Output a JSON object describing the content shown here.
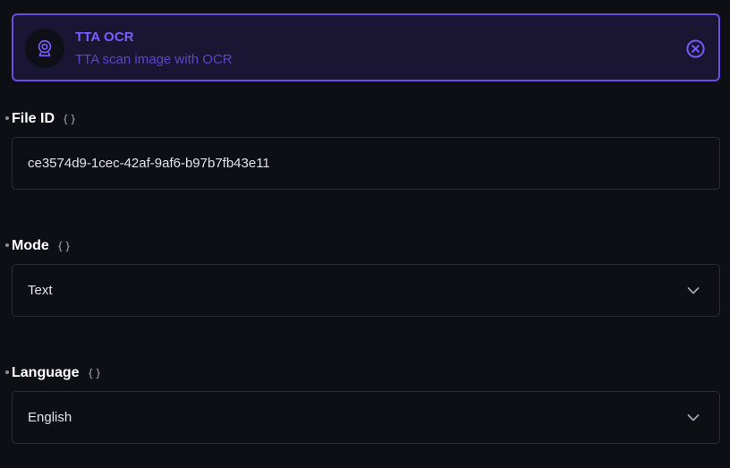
{
  "header": {
    "title": "TTA OCR",
    "subtitle": "TTA scan image with OCR",
    "icon": "webcam-icon",
    "close_icon": "close-circle-icon",
    "accent_color": "#7c5cff",
    "border_color": "#6b4ee6"
  },
  "fields": {
    "file_id": {
      "label": "File ID",
      "value": "ce3574d9-1cec-42af-9af6-b97b7fb43e11",
      "variable_icon": "braces-icon"
    },
    "mode": {
      "label": "Mode",
      "selected": "Text",
      "variable_icon": "braces-icon",
      "dropdown_icon": "chevron-down-icon"
    },
    "language": {
      "label": "Language",
      "selected": "English",
      "variable_icon": "braces-icon",
      "dropdown_icon": "chevron-down-icon"
    }
  }
}
